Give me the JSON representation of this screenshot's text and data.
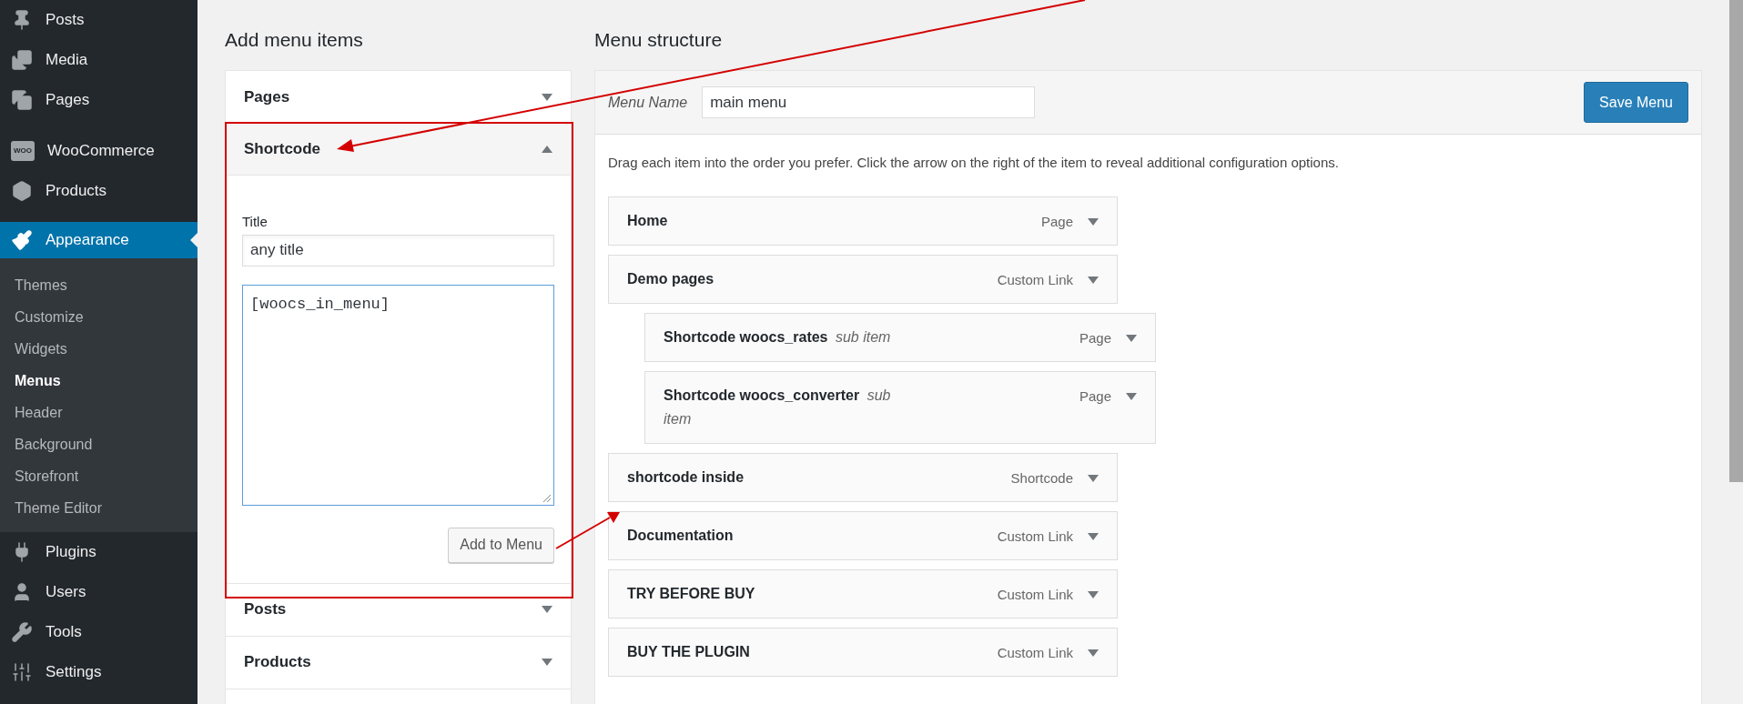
{
  "sidebar": {
    "groups": [
      [
        {
          "label": "Posts",
          "selected": false
        },
        {
          "label": "Media",
          "selected": false
        },
        {
          "label": "Pages",
          "selected": false
        }
      ],
      [
        {
          "label": "WooCommerce",
          "selected": false,
          "icon_text": "WOO"
        },
        {
          "label": "Products",
          "selected": false
        }
      ],
      [
        {
          "label": "Appearance",
          "selected": true,
          "children": [
            {
              "label": "Themes",
              "selected": false
            },
            {
              "label": "Customize",
              "selected": false
            },
            {
              "label": "Widgets",
              "selected": false
            },
            {
              "label": "Menus",
              "selected": true
            },
            {
              "label": "Header",
              "selected": false
            },
            {
              "label": "Background",
              "selected": false
            },
            {
              "label": "Storefront",
              "selected": false
            },
            {
              "label": "Theme Editor",
              "selected": false
            }
          ]
        },
        {
          "label": "Plugins",
          "selected": false
        },
        {
          "label": "Users",
          "selected": false
        },
        {
          "label": "Tools",
          "selected": false
        },
        {
          "label": "Settings",
          "selected": false
        }
      ]
    ]
  },
  "add_menu_items": {
    "title": "Add menu items",
    "sections": [
      {
        "label": "Pages",
        "expanded": false
      },
      {
        "label": "Shortcode",
        "expanded": true,
        "title_label": "Title",
        "title_value": "any title",
        "shortcode_value": "[woocs_in_menu]",
        "button": "Add to Menu"
      },
      {
        "label": "Posts",
        "expanded": false
      },
      {
        "label": "Products",
        "expanded": false
      }
    ]
  },
  "menu_structure": {
    "title": "Menu structure",
    "menu_name_label": "Menu Name",
    "menu_name_value": "main menu",
    "save_button": "Save Menu",
    "instructions": "Drag each item into the order you prefer. Click the arrow on the right of the item to reveal additional configuration options.",
    "items": [
      {
        "title": "Home",
        "type": "Page"
      },
      {
        "title": "Demo pages",
        "type": "Custom Link",
        "children": [
          {
            "title": "Shortcode woocs_rates",
            "note": "sub item",
            "type": "Page"
          },
          {
            "title": "Shortcode woocs_converter",
            "note": "sub item",
            "type": "Page"
          }
        ]
      },
      {
        "title": "shortcode inside",
        "type": "Shortcode"
      },
      {
        "title": "Documentation",
        "type": "Custom Link"
      },
      {
        "title": "TRY BEFORE BUY",
        "type": "Custom Link"
      },
      {
        "title": "BUY THE PLUGIN",
        "type": "Custom Link"
      }
    ]
  }
}
